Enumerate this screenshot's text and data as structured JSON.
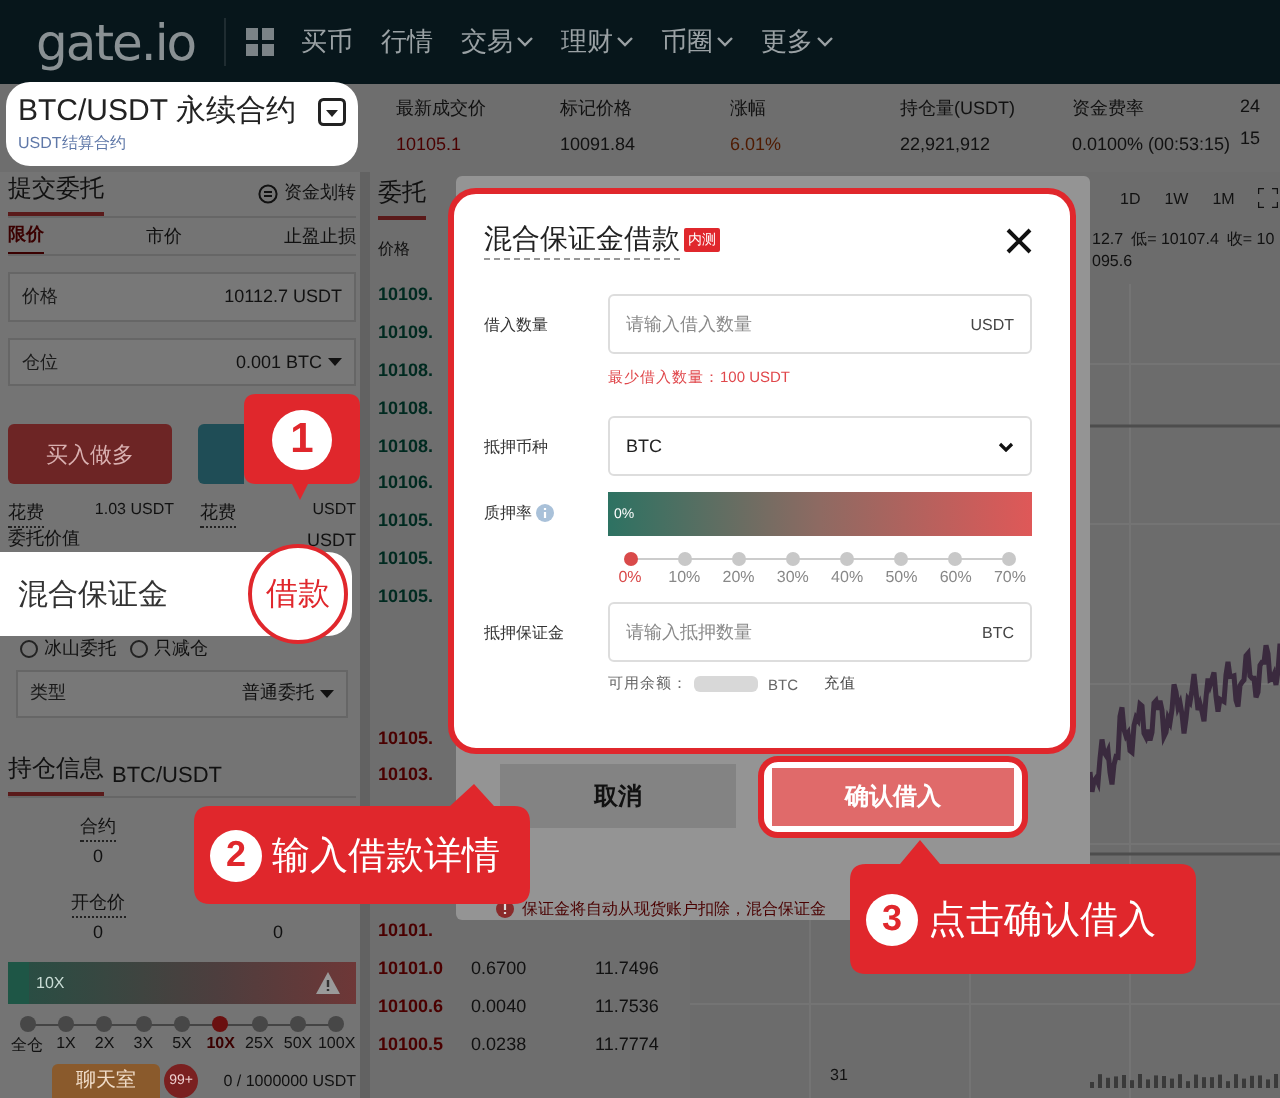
{
  "nav": {
    "logo": "gate.io",
    "items": [
      {
        "label": "买币",
        "dropdown": false
      },
      {
        "label": "行情",
        "dropdown": false
      },
      {
        "label": "交易",
        "dropdown": true
      },
      {
        "label": "理财",
        "dropdown": true
      },
      {
        "label": "币圈",
        "dropdown": true
      },
      {
        "label": "更多",
        "dropdown": true
      }
    ]
  },
  "contract": {
    "title": "BTC/USDT 永续合约",
    "subtitle": "USDT结算合约"
  },
  "stats": [
    {
      "label": "最新成交价",
      "value": "10105.1",
      "color": "#4a0000"
    },
    {
      "label": "标记价格",
      "value": "10091.84",
      "color": "#111111"
    },
    {
      "label": "涨幅",
      "value": "6.01%",
      "color": "#4f1a00"
    },
    {
      "label": "持仓量(USDT)",
      "value": "22,921,912",
      "color": "#111111"
    },
    {
      "label": "资金费率",
      "value": "0.0100% (00:53:15)",
      "color": "#111111"
    },
    {
      "label": "24",
      "value": "15",
      "color": "#111111"
    }
  ],
  "order_form": {
    "title": "提交委托",
    "transfer": "资金划转",
    "tabs": [
      {
        "label": "限价",
        "selected": true
      },
      {
        "label": "市价",
        "selected": false
      },
      {
        "label": "止盈止损",
        "selected": false
      }
    ],
    "price": {
      "label": "价格",
      "value": "10112.7 USDT"
    },
    "size": {
      "label": "仓位",
      "value": "0.001 BTC"
    },
    "buy_button": "买入做多",
    "costs": [
      {
        "label": "花费",
        "value": "1.03 USDT"
      },
      {
        "label": "花费",
        "value": "USDT"
      }
    ],
    "order_value": {
      "label": "委托价值",
      "value": "USDT"
    },
    "options": [
      {
        "label": "冰山委托",
        "checked": false
      },
      {
        "label": "只减仓",
        "checked": false
      }
    ],
    "type": {
      "label": "类型",
      "value": "普通委托"
    }
  },
  "margin_card": {
    "label": "混合保证金",
    "action": "借款"
  },
  "position": {
    "title": "持仓信息",
    "pair": "BTC/USDT",
    "fields": [
      {
        "label": "合约",
        "value": "0"
      },
      {
        "label": "开仓价",
        "value": "0"
      },
      {
        "value": "0"
      }
    ],
    "leverage_bar": "10X",
    "leverage_marks": [
      {
        "label": "全仓",
        "selected": false
      },
      {
        "label": "1X",
        "selected": false
      },
      {
        "label": "2X",
        "selected": false
      },
      {
        "label": "3X",
        "selected": false
      },
      {
        "label": "5X",
        "selected": false
      },
      {
        "label": "10X",
        "selected": true
      },
      {
        "label": "25X",
        "selected": false
      },
      {
        "label": "50X",
        "selected": false
      },
      {
        "label": "100X",
        "selected": false
      }
    ],
    "chat": "聊天室",
    "chat_badge": "99+",
    "margin_usage": "0 / 1000000 USDT"
  },
  "orderbook": {
    "title": "委托",
    "column": "价格",
    "groups": [
      {
        "color": "#002a20",
        "rows": [
          {
            "price": "10109."
          },
          {
            "price": "10109."
          },
          {
            "price": "10108."
          },
          {
            "price": "10108."
          },
          {
            "price": "10108."
          },
          {
            "price": "10106."
          },
          {
            "price": "10105."
          },
          {
            "price": "10105."
          },
          {
            "price": "10105."
          }
        ]
      },
      {
        "color": "#4a0000",
        "rows": [
          {
            "price": "10105."
          },
          {
            "price": "10103."
          }
        ]
      },
      {
        "color": "#4a0000",
        "rows": [
          {
            "price": "10101."
          },
          {
            "price": "10101.0",
            "amount": "0.6700",
            "total": "11.7496"
          },
          {
            "price": "10100.6",
            "amount": "0.0040",
            "total": "11.7536"
          },
          {
            "price": "10100.5",
            "amount": "0.0238",
            "total": "11.7774"
          }
        ]
      }
    ]
  },
  "chart": {
    "intervals": [
      "1D",
      "1W",
      "1M"
    ],
    "info": [
      "12.7",
      "低= 10107.4",
      "收= 10"
    ],
    "info2": "095.6",
    "axis_label": "31"
  },
  "dialog": {
    "title": "混合保证金借款",
    "badge": "内测",
    "fields": [
      {
        "kind": "input",
        "label": "借入数量",
        "placeholder": "请输入借入数量",
        "unit": "USDT",
        "hint": "最少借入数量：100 USDT"
      },
      {
        "kind": "select",
        "label": "抵押币种",
        "value": "BTC"
      },
      {
        "kind": "ratio",
        "label": "质押率",
        "bar_text": "0%",
        "slider": {
          "marks": [
            {
              "label": "0%",
              "selected": true
            },
            {
              "label": "10%",
              "selected": false
            },
            {
              "label": "20%",
              "selected": false
            },
            {
              "label": "30%",
              "selected": false
            },
            {
              "label": "40%",
              "selected": false
            },
            {
              "label": "50%",
              "selected": false
            },
            {
              "label": "60%",
              "selected": false
            },
            {
              "label": "70%",
              "selected": false
            }
          ]
        }
      },
      {
        "kind": "input",
        "label": "抵押保证金",
        "placeholder": "请输入抵押数量",
        "unit": "BTC",
        "balance": {
          "label": "可用余额：",
          "unit": "BTC",
          "action": "充值"
        }
      }
    ],
    "cancel": "取消",
    "confirm": "确认借入",
    "notice": "保证金将自动从现货账户扣除，混合保证金"
  },
  "callouts": [
    {
      "number": "1"
    },
    {
      "number": "2",
      "text": "输入借款详情"
    },
    {
      "number": "3",
      "text": "点击确认借入"
    }
  ]
}
